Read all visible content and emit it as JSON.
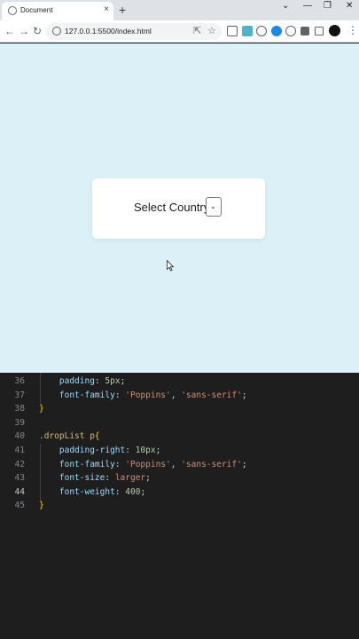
{
  "browser": {
    "tab_title": "Document",
    "tab_close": "×",
    "new_tab": "+",
    "url": "127.0.0.1:5500/index.html",
    "win_controls": [
      "⌄",
      "—",
      "❐",
      "✕"
    ]
  },
  "page": {
    "label": "Select Country:"
  },
  "editor": {
    "lines": [
      {
        "n": "36",
        "parts": [
          [
            "    ",
            "punc"
          ],
          [
            "padding",
            "prop"
          ],
          [
            ": ",
            "punc"
          ],
          [
            "5px",
            "num"
          ],
          [
            ";",
            "punc"
          ]
        ]
      },
      {
        "n": "37",
        "parts": [
          [
            "    ",
            "punc"
          ],
          [
            "font-family",
            "prop"
          ],
          [
            ": ",
            "punc"
          ],
          [
            "'Poppins'",
            "str"
          ],
          [
            ", ",
            "punc"
          ],
          [
            "'sans-serif'",
            "str"
          ],
          [
            ";",
            "punc"
          ]
        ]
      },
      {
        "n": "38",
        "parts": [
          [
            "}",
            "brace"
          ]
        ]
      },
      {
        "n": "39",
        "parts": []
      },
      {
        "n": "40",
        "parts": [
          [
            ".dropList p",
            "sel"
          ],
          [
            "{",
            "brace"
          ]
        ]
      },
      {
        "n": "41",
        "parts": [
          [
            "    ",
            "punc"
          ],
          [
            "padding-right",
            "prop"
          ],
          [
            ": ",
            "punc"
          ],
          [
            "10px",
            "num"
          ],
          [
            ";",
            "punc"
          ]
        ]
      },
      {
        "n": "42",
        "parts": [
          [
            "    ",
            "punc"
          ],
          [
            "font-family",
            "prop"
          ],
          [
            ": ",
            "punc"
          ],
          [
            "'Poppins'",
            "str"
          ],
          [
            ", ",
            "punc"
          ],
          [
            "'sans-serif'",
            "str"
          ],
          [
            ";",
            "punc"
          ]
        ]
      },
      {
        "n": "43",
        "parts": [
          [
            "    ",
            "punc"
          ],
          [
            "font-size",
            "prop"
          ],
          [
            ": ",
            "punc"
          ],
          [
            "larger",
            "str"
          ],
          [
            ";",
            "punc"
          ]
        ]
      },
      {
        "n": "44",
        "parts": [
          [
            "    ",
            "punc"
          ],
          [
            "font-weight",
            "prop"
          ],
          [
            ": ",
            "punc"
          ],
          [
            "400",
            "num"
          ],
          [
            ";",
            "punc"
          ]
        ]
      },
      {
        "n": "45",
        "parts": [
          [
            "}",
            "brace"
          ]
        ]
      }
    ],
    "active_line": "44"
  },
  "colors": {
    "page_bg": "#dcf0f8",
    "editor_bg": "#1e1e1e"
  }
}
